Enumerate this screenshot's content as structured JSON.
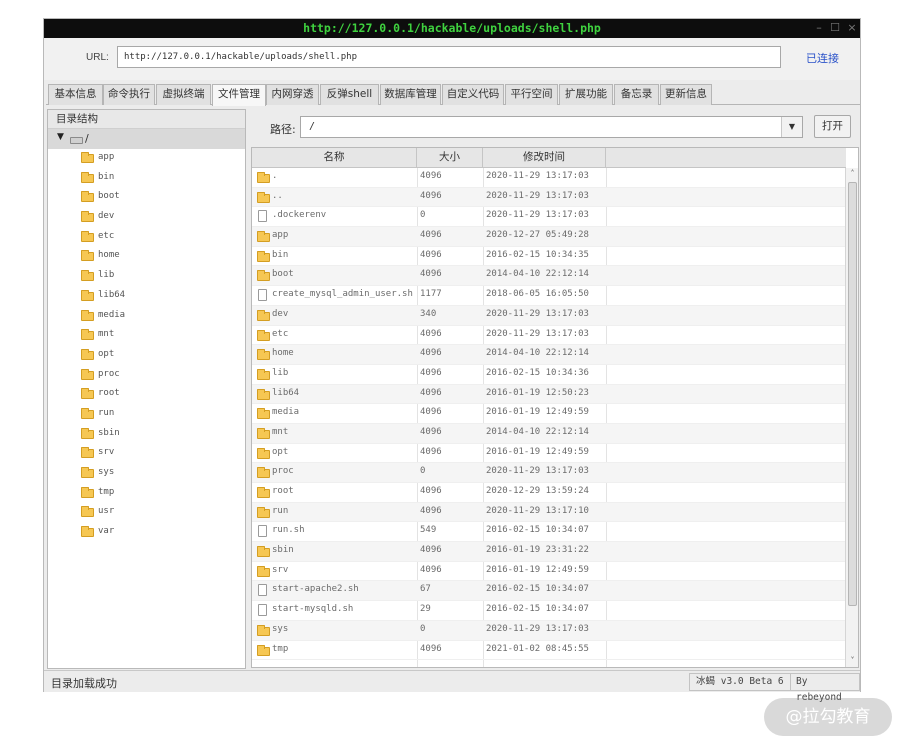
{
  "window": {
    "title": "http://127.0.0.1/hackable/uploads/shell.php",
    "controls": [
      "–",
      "☐",
      "×"
    ]
  },
  "urlbar": {
    "label": "URL:",
    "value": "http://127.0.0.1/hackable/uploads/shell.php",
    "status": "已连接"
  },
  "tabs": [
    {
      "label": "基本信息"
    },
    {
      "label": "命令执行"
    },
    {
      "label": "虚拟终端"
    },
    {
      "label": "文件管理",
      "active": true
    },
    {
      "label": "内网穿透"
    },
    {
      "label": "反弹shell"
    },
    {
      "label": "数据库管理"
    },
    {
      "label": "自定义代码"
    },
    {
      "label": "平行空间"
    },
    {
      "label": "扩展功能"
    },
    {
      "label": "备忘录"
    },
    {
      "label": "更新信息"
    }
  ],
  "tree": {
    "header": "目录结构",
    "root_label": "/",
    "toggle": "▼",
    "folders": [
      "app",
      "bin",
      "boot",
      "dev",
      "etc",
      "home",
      "lib",
      "lib64",
      "media",
      "mnt",
      "opt",
      "proc",
      "root",
      "run",
      "sbin",
      "srv",
      "sys",
      "tmp",
      "usr",
      "var"
    ]
  },
  "path": {
    "label": "路径:",
    "value": "/",
    "dropdown_icon": "▼",
    "open_button": "打开"
  },
  "table": {
    "columns": [
      "名称",
      "大小",
      "修改时间"
    ],
    "rows": [
      {
        "icon": "folder",
        "name": ".",
        "size": "4096",
        "time": "2020-11-29 13:17:03"
      },
      {
        "icon": "folder",
        "name": "..",
        "size": "4096",
        "time": "2020-11-29 13:17:03"
      },
      {
        "icon": "file",
        "name": ".dockerenv",
        "size": "0",
        "time": "2020-11-29 13:17:03"
      },
      {
        "icon": "folder",
        "name": "app",
        "size": "4096",
        "time": "2020-12-27 05:49:28"
      },
      {
        "icon": "folder",
        "name": "bin",
        "size": "4096",
        "time": "2016-02-15 10:34:35"
      },
      {
        "icon": "folder",
        "name": "boot",
        "size": "4096",
        "time": "2014-04-10 22:12:14"
      },
      {
        "icon": "file",
        "name": "create_mysql_admin_user.sh",
        "size": "1177",
        "time": "2018-06-05 16:05:50"
      },
      {
        "icon": "folder",
        "name": "dev",
        "size": "340",
        "time": "2020-11-29 13:17:03"
      },
      {
        "icon": "folder",
        "name": "etc",
        "size": "4096",
        "time": "2020-11-29 13:17:03"
      },
      {
        "icon": "folder",
        "name": "home",
        "size": "4096",
        "time": "2014-04-10 22:12:14"
      },
      {
        "icon": "folder",
        "name": "lib",
        "size": "4096",
        "time": "2016-02-15 10:34:36"
      },
      {
        "icon": "folder",
        "name": "lib64",
        "size": "4096",
        "time": "2016-01-19 12:50:23"
      },
      {
        "icon": "folder",
        "name": "media",
        "size": "4096",
        "time": "2016-01-19 12:49:59"
      },
      {
        "icon": "folder",
        "name": "mnt",
        "size": "4096",
        "time": "2014-04-10 22:12:14"
      },
      {
        "icon": "folder",
        "name": "opt",
        "size": "4096",
        "time": "2016-01-19 12:49:59"
      },
      {
        "icon": "folder",
        "name": "proc",
        "size": "0",
        "time": "2020-11-29 13:17:03"
      },
      {
        "icon": "folder",
        "name": "root",
        "size": "4096",
        "time": "2020-12-29 13:59:24"
      },
      {
        "icon": "folder",
        "name": "run",
        "size": "4096",
        "time": "2020-11-29 13:17:10"
      },
      {
        "icon": "file",
        "name": "run.sh",
        "size": "549",
        "time": "2016-02-15 10:34:07"
      },
      {
        "icon": "folder",
        "name": "sbin",
        "size": "4096",
        "time": "2016-01-19 23:31:22"
      },
      {
        "icon": "folder",
        "name": "srv",
        "size": "4096",
        "time": "2016-01-19 12:49:59"
      },
      {
        "icon": "file",
        "name": "start-apache2.sh",
        "size": "67",
        "time": "2016-02-15 10:34:07"
      },
      {
        "icon": "file",
        "name": "start-mysqld.sh",
        "size": "29",
        "time": "2016-02-15 10:34:07"
      },
      {
        "icon": "folder",
        "name": "sys",
        "size": "0",
        "time": "2020-11-29 13:17:03"
      },
      {
        "icon": "folder",
        "name": "tmp",
        "size": "4096",
        "time": "2021-01-02 08:45:55"
      }
    ],
    "scroll_up": "˄",
    "scroll_down": "˅"
  },
  "statusbar": {
    "text": "目录加载成功",
    "version": "冰蝎 v3.0 Beta 6",
    "author": "By rebeyond"
  },
  "watermark": "@拉勾教育",
  "colors": {
    "title_text": "#3fd23f",
    "title_bg": "#0d0d0d",
    "link_status": "#2a52c9",
    "folder": "#f6c753"
  }
}
